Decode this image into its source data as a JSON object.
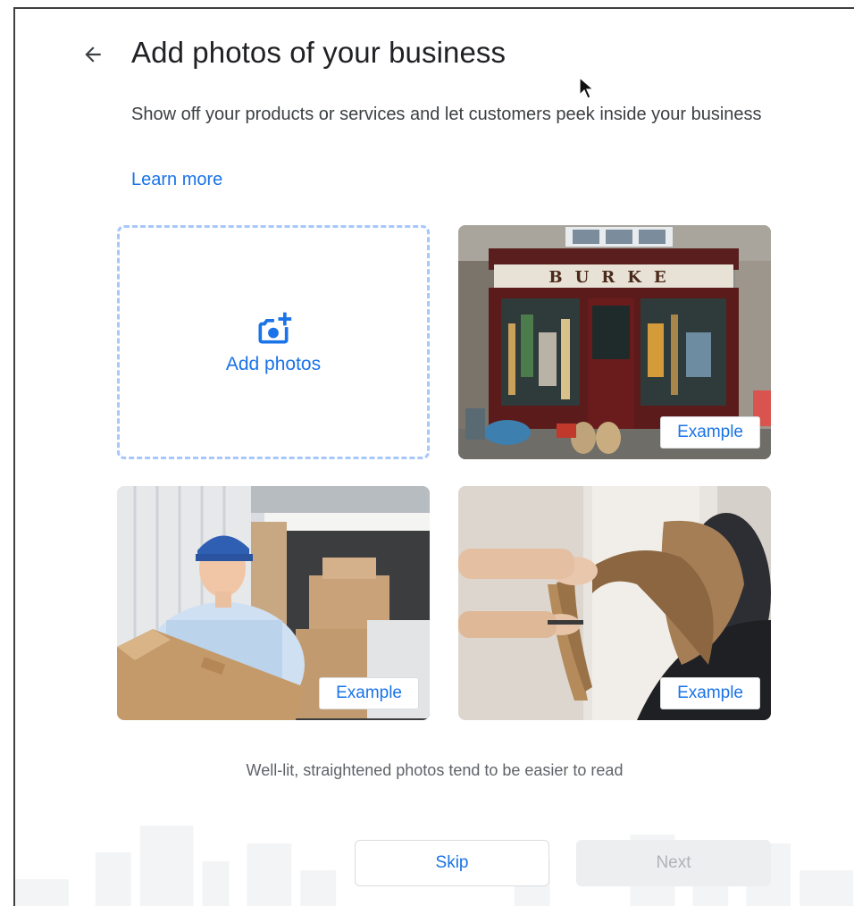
{
  "header": {
    "title": "Add photos of your business",
    "back_icon": "arrow-back-icon"
  },
  "description": "Show off your products or services and let customers peek inside your business",
  "learn_more": "Learn more",
  "add_tile": {
    "label": "Add photos",
    "icon": "add-photo-camera-icon"
  },
  "examples": [
    {
      "badge": "Example",
      "sign_text": "BURKE"
    },
    {
      "badge": "Example"
    },
    {
      "badge": "Example"
    }
  ],
  "hint": "Well-lit, straightened photos tend to be easier to read",
  "buttons": {
    "skip": "Skip",
    "next": "Next"
  },
  "colors": {
    "accent": "#1a73e8",
    "dashed_border": "#a8c7fa",
    "disabled_bg": "#eceeef",
    "disabled_text": "#b0b3b8"
  }
}
